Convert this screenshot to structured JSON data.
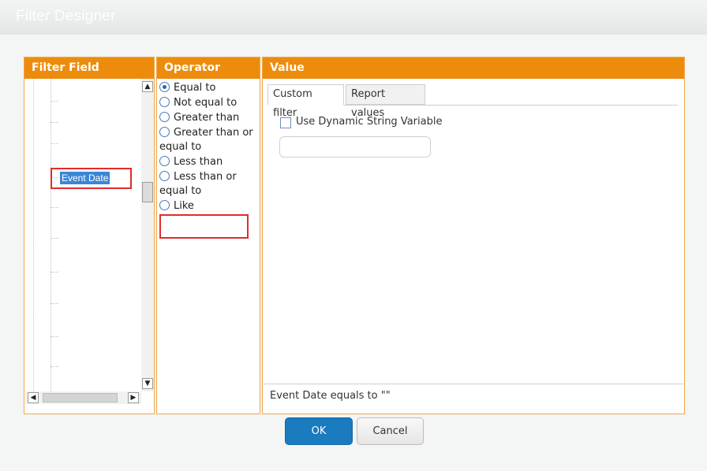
{
  "dialog": {
    "title": "Filter Designer"
  },
  "filter_field": {
    "header": "Filter Field",
    "selected_item": "Event Date",
    "scroll_up": "▲",
    "scroll_down": "▼",
    "scroll_left": "◀",
    "scroll_right": "▶"
  },
  "operator": {
    "header": "Operator",
    "options": [
      "Equal to",
      "Not equal to",
      "Greater than",
      "Greater than or equal to",
      "Less than",
      "Less than or equal to",
      "Like"
    ],
    "selected": "Equal to"
  },
  "value": {
    "header": "Value",
    "tabs": [
      "Custom filter",
      "Report values"
    ],
    "active_tab": "Custom filter",
    "dynamic_checkbox_label": "Use Dynamic String Variable",
    "dynamic_checkbox_checked": false,
    "string_input_value": "",
    "summary": "Event Date equals to \"\""
  },
  "buttons": {
    "ok": "OK",
    "cancel": "Cancel"
  },
  "colors": {
    "header": "#ed8c0c",
    "selection": "#3a86d6",
    "ok_button": "#1a7bbf",
    "highlight": "#e32b2b"
  }
}
